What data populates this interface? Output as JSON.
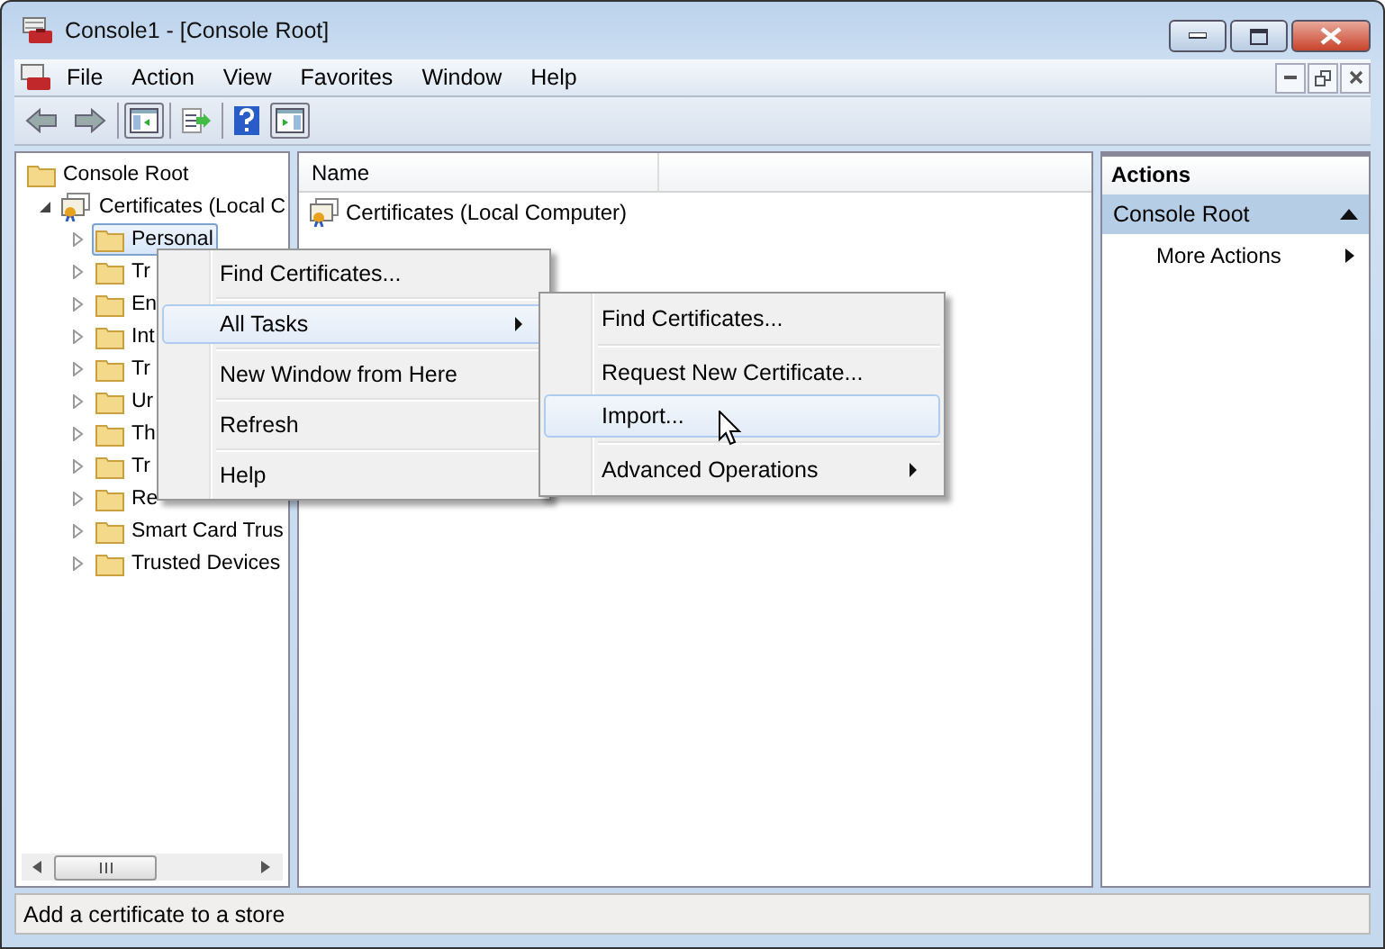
{
  "window": {
    "title": "Console1 - [Console Root]"
  },
  "menu_bar": [
    "File",
    "Action",
    "View",
    "Favorites",
    "Window",
    "Help"
  ],
  "tree": {
    "label": "Console Root",
    "children": [
      {
        "label": "Certificates (Local C",
        "expanded": true,
        "children": [
          {
            "label": "Personal",
            "expanded": false,
            "selected": true
          },
          {
            "label": "Tr",
            "expanded": false,
            "selected": false
          },
          {
            "label": "En",
            "expanded": false,
            "selected": false
          },
          {
            "label": "Int",
            "expanded": false,
            "selected": false
          },
          {
            "label": "Tr",
            "expanded": false,
            "selected": false
          },
          {
            "label": "Ur",
            "expanded": false,
            "selected": false
          },
          {
            "label": "Th",
            "expanded": false,
            "selected": false
          },
          {
            "label": "Tr",
            "expanded": false,
            "selected": false
          },
          {
            "label": "Re",
            "expanded": false,
            "selected": false
          },
          {
            "label": "Smart Card Trus",
            "expanded": false,
            "selected": false
          },
          {
            "label": "Trusted Devices",
            "expanded": false,
            "selected": false
          }
        ]
      }
    ]
  },
  "list": {
    "columns": [
      "Name"
    ],
    "rows": [
      "Certificates (Local Computer)"
    ]
  },
  "actions": {
    "title": "Actions",
    "section": "Console Root",
    "items": [
      "More Actions"
    ]
  },
  "context_menu": [
    {
      "kind": "item",
      "label": "Find Certificates...",
      "selected": false,
      "submenu": false
    },
    {
      "kind": "separator"
    },
    {
      "kind": "item",
      "label": "All Tasks",
      "selected": true,
      "submenu": true
    },
    {
      "kind": "separator"
    },
    {
      "kind": "item",
      "label": "New Window from Here",
      "selected": false,
      "submenu": false
    },
    {
      "kind": "separator"
    },
    {
      "kind": "item",
      "label": "Refresh",
      "selected": false,
      "submenu": false
    },
    {
      "kind": "separator"
    },
    {
      "kind": "item",
      "label": "Help",
      "selected": false,
      "submenu": false
    }
  ],
  "submenu": [
    {
      "kind": "item",
      "label": "Find Certificates...",
      "selected": false,
      "submenu": false
    },
    {
      "kind": "separator"
    },
    {
      "kind": "item",
      "label": "Request New Certificate...",
      "selected": false,
      "submenu": false
    },
    {
      "kind": "item",
      "label": "Import...",
      "selected": true,
      "submenu": false
    },
    {
      "kind": "separator"
    },
    {
      "kind": "item",
      "label": "Advanced Operations",
      "selected": false,
      "submenu": true
    }
  ],
  "status_bar": "Add a certificate to a store"
}
